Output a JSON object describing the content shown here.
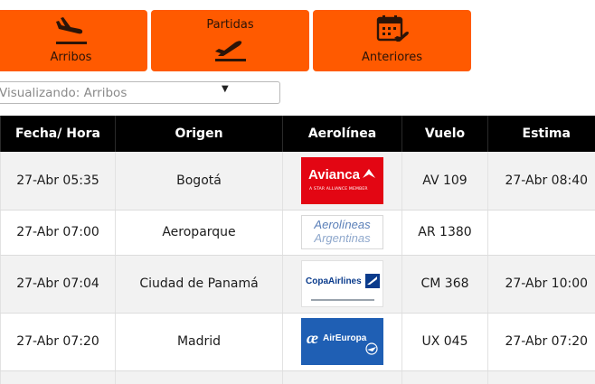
{
  "nav": {
    "arrivals_label": "Arribos",
    "departures_label": "Partidas",
    "previous_label": "Anteriores"
  },
  "filter": {
    "value": "Visualizando: Arribos",
    "caret": "▼"
  },
  "table": {
    "headers": [
      "Fecha/ Hora",
      "Origen",
      "Aerolínea",
      "Vuelo",
      "Estima"
    ],
    "rows": [
      {
        "datetime": "27-Abr 05:35",
        "origin": "Bogotá",
        "airline_logo": "Avianca",
        "airline_tagline": "A STAR ALLIANCE MEMBER",
        "flight": "AV 109",
        "estimate": "27-Abr 08:40"
      },
      {
        "datetime": "27-Abr 07:00",
        "origin": "Aeroparque",
        "airline_logo": "Aerolíneas",
        "airline_logo_line2": "Argentinas",
        "flight": "AR 1380",
        "estimate": ""
      },
      {
        "datetime": "27-Abr 07:04",
        "origin": "Ciudad de Panamá",
        "airline_logo": "CopaAirlines",
        "flight": "CM 368",
        "estimate": "27-Abr 10:00"
      },
      {
        "datetime": "27-Abr 07:20",
        "origin": "Madrid",
        "airline_logo": "AirEuropa",
        "flight": "UX 045",
        "estimate": "27-Abr 07:20"
      }
    ]
  },
  "colors": {
    "accent": "#ff5a00",
    "header_bg": "#000000",
    "avianca": "#e30613",
    "aerolineas": "#5a7fb8",
    "copa": "#0a3b8c",
    "aireuropa": "#1f5fb4"
  },
  "icons": {
    "arrivals": "plane-landing-icon",
    "departures": "plane-takeoff-icon",
    "previous": "calendar-plane-icon"
  }
}
